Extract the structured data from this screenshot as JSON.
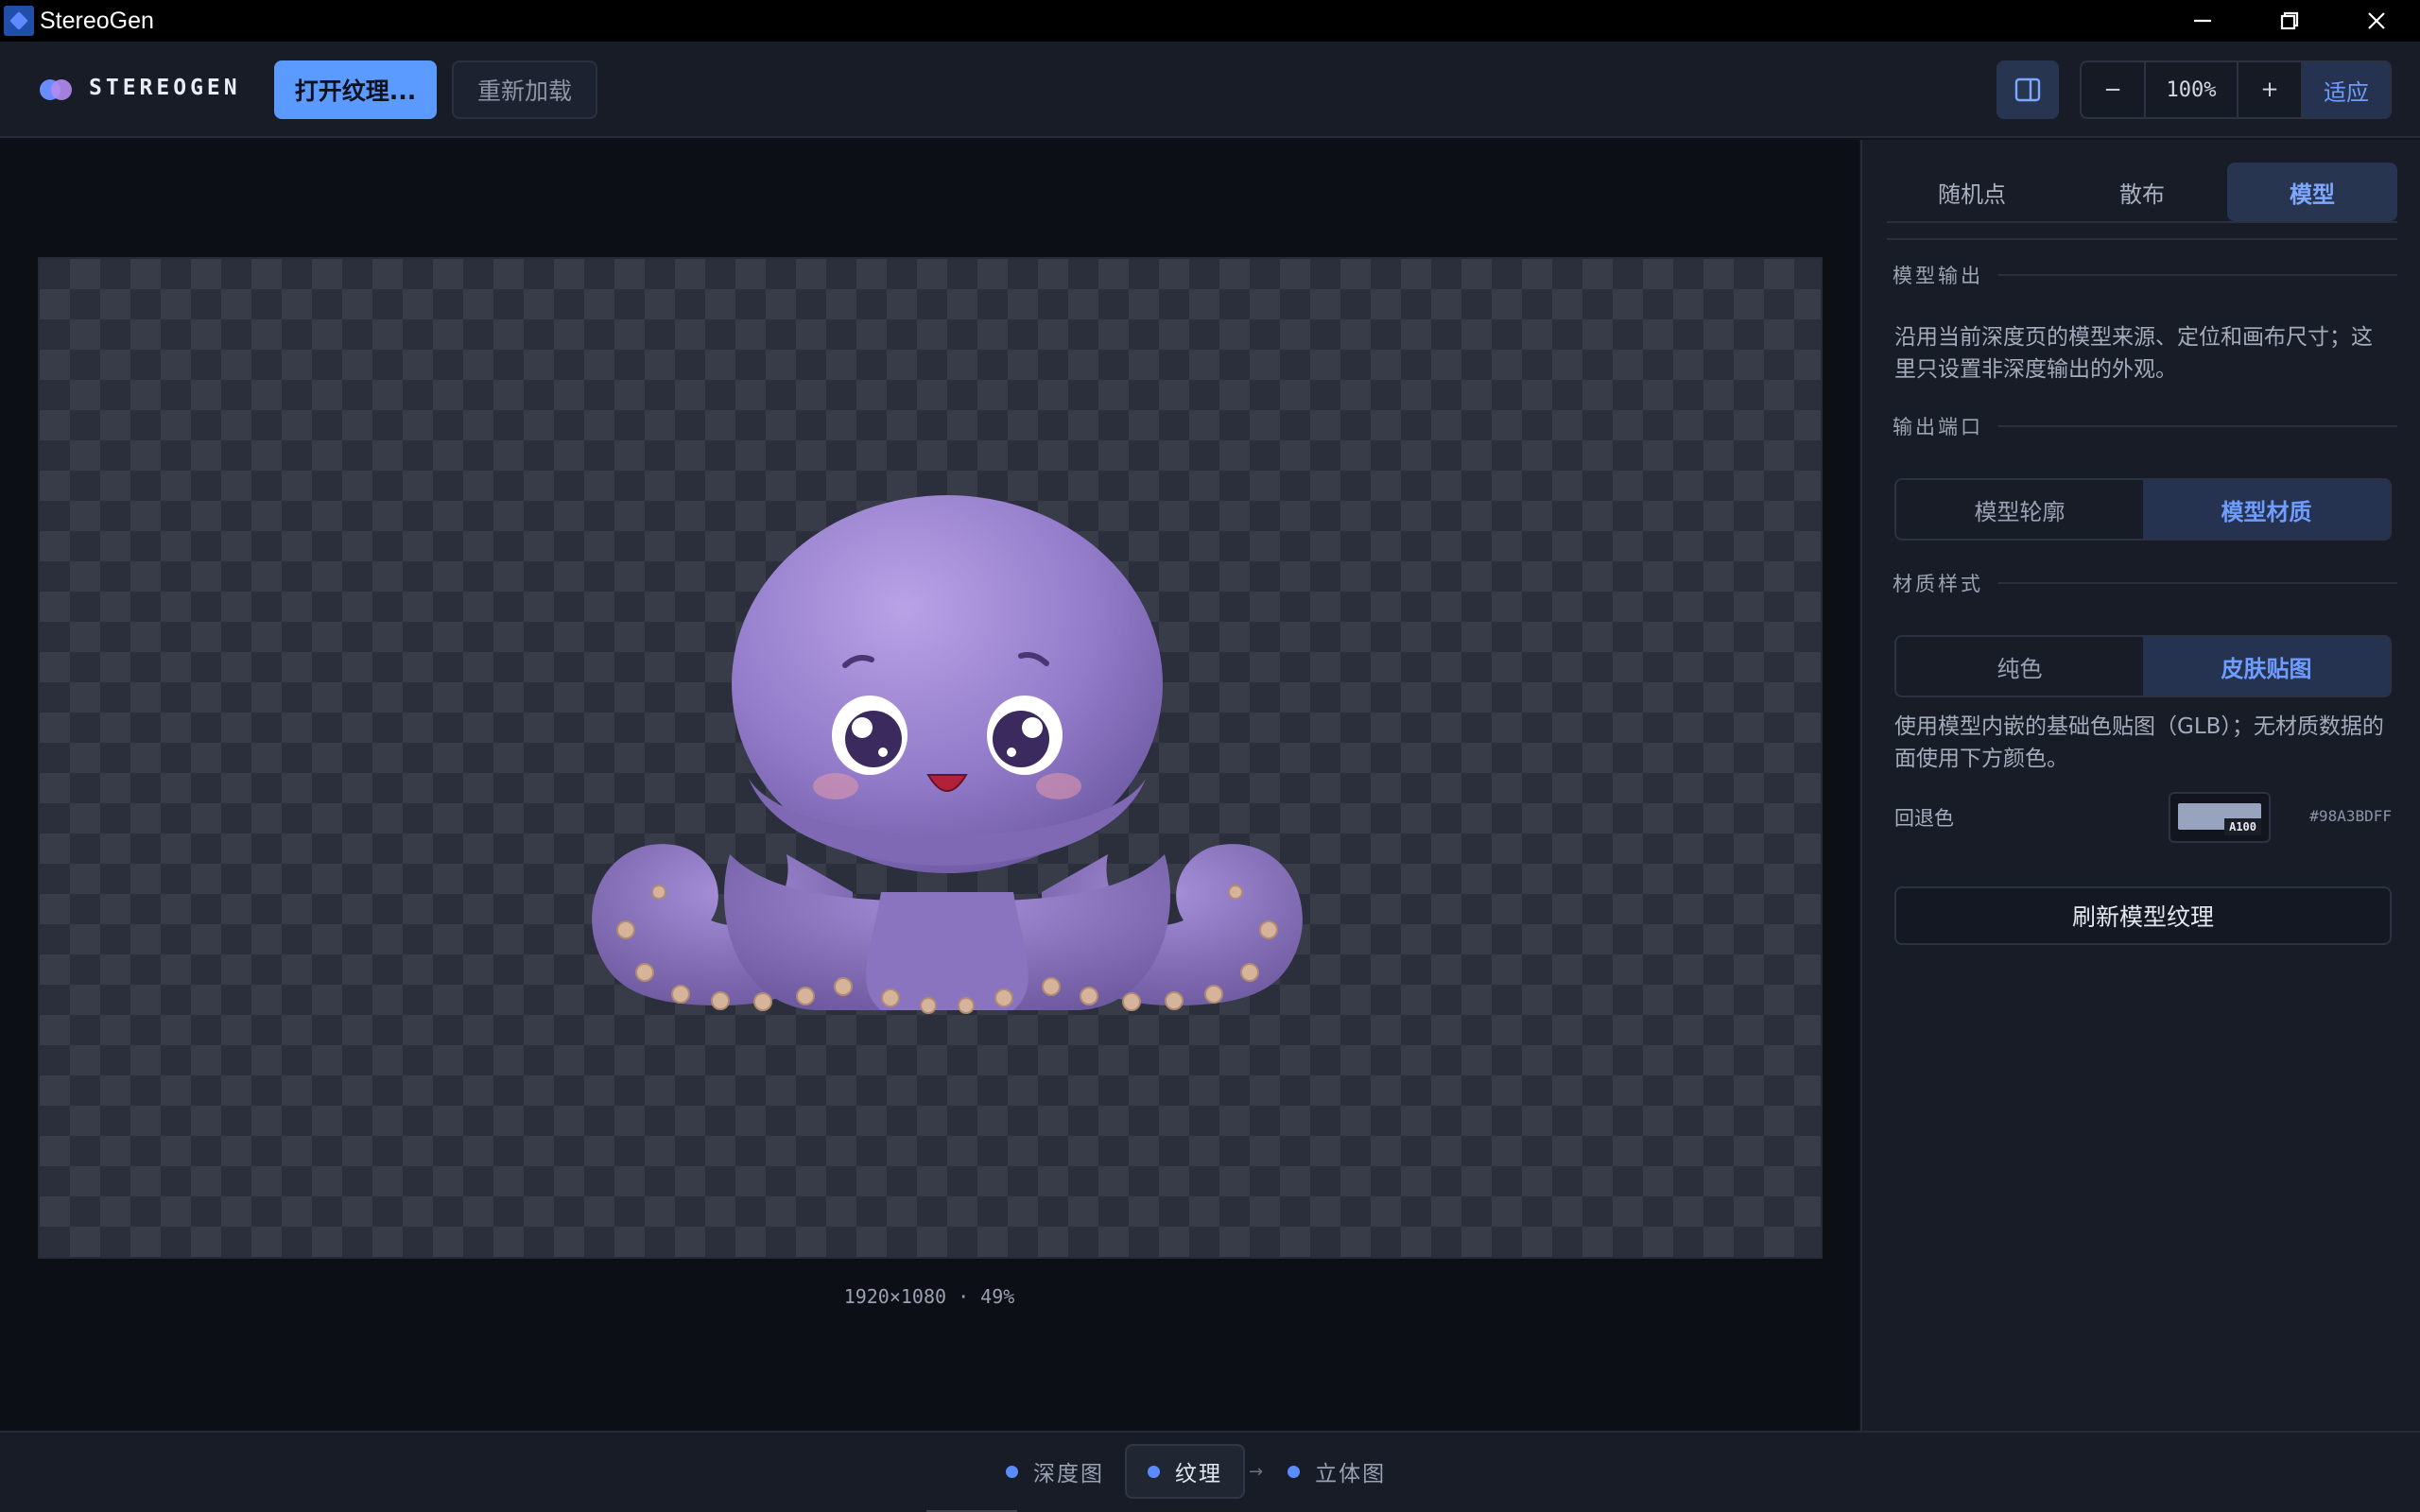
{
  "window": {
    "title": "StereoGen"
  },
  "toolbar": {
    "brand": "STEREOGEN",
    "open_texture": "打开纹理...",
    "reload": "重新加载",
    "zoom_out": "−",
    "zoom_level": "100%",
    "zoom_in": "+",
    "fit": "适应"
  },
  "canvas": {
    "caption": "1920×1080 · 49%"
  },
  "panel": {
    "tabs": [
      {
        "label": "随机点"
      },
      {
        "label": "散布"
      },
      {
        "label": "模型",
        "active": true
      }
    ],
    "section_model_output": "模型输出",
    "model_output_desc": "沿用当前深度页的模型来源、定位和画布尺寸；这里只设置非深度输出的外观。",
    "section_output_port": "输出端口",
    "output_port_options": [
      "模型轮廓",
      "模型材质"
    ],
    "output_port_selected": "模型材质",
    "section_material_style": "材质样式",
    "material_style_options": [
      "纯色",
      "皮肤贴图"
    ],
    "material_style_selected": "皮肤贴图",
    "material_desc": "使用模型内嵌的基础色贴图（GLB）；无材质数据的面使用下方颜色。",
    "fallback_color_label": "回退色",
    "fallback_color_badge": "A100",
    "fallback_color_hex": "#98A3BDFF",
    "refresh_button": "刷新模型纹理"
  },
  "bottombar": {
    "steps": [
      {
        "label": "深度图"
      },
      {
        "label": "纹理",
        "active": true
      },
      {
        "label": "立体图"
      }
    ]
  },
  "colors": {
    "accent": "#5B9BFF",
    "fallback_swatch": "#98A3BD"
  },
  "icons": {
    "panel_toggle": "panel-right-icon",
    "minimize": "minimize-icon",
    "maximize": "restore-icon",
    "close": "close-icon"
  }
}
